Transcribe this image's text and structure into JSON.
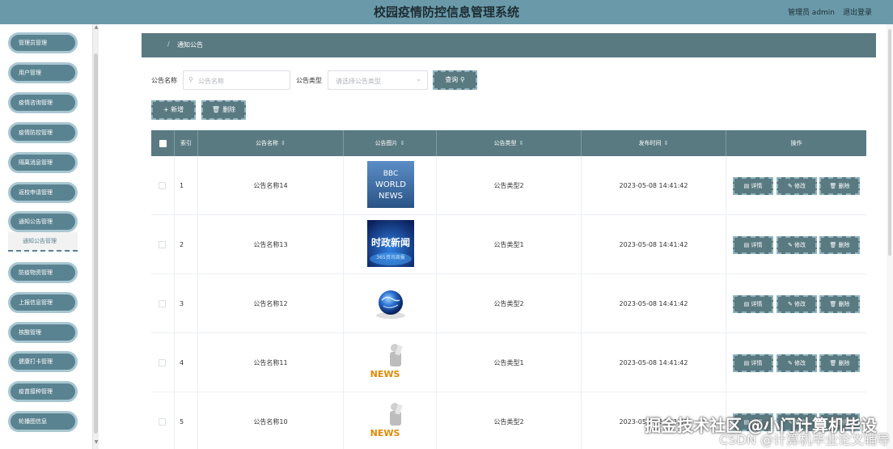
{
  "header": {
    "title": "校园疫情防控信息管理系统",
    "user": "管理员 admin",
    "logout": "退出登录"
  },
  "sidebar": {
    "items": [
      {
        "label": "管理员管理"
      },
      {
        "label": "用户管理"
      },
      {
        "label": "疫情咨询管理"
      },
      {
        "label": "疫情防控管理"
      },
      {
        "label": "隔离消息管理"
      },
      {
        "label": "返校申请管理"
      },
      {
        "label": "通知公告管理"
      },
      {
        "label": "通知公告管理",
        "sub": true
      },
      {
        "label": "防疫物资管理"
      },
      {
        "label": "上报信息管理"
      },
      {
        "label": "核酸管理"
      },
      {
        "label": "健康打卡管理"
      },
      {
        "label": "疫苗接种管理"
      },
      {
        "label": "轮播图信息"
      }
    ]
  },
  "breadcrumb": {
    "slash": "/",
    "current": "通知公告"
  },
  "search": {
    "name_label": "公告名称",
    "name_placeholder": "公告名称",
    "type_label": "公告类型",
    "type_placeholder": "请选择公告类型",
    "query_label": "查询"
  },
  "toolbar": {
    "add_label": "+ 新增",
    "delete_label": "删除"
  },
  "table": {
    "headers": {
      "index": "索引",
      "name": "公告名称",
      "image": "公告图片",
      "type": "公告类型",
      "time": "发布时间",
      "ops": "操作"
    },
    "rows": [
      {
        "index": "1",
        "name": "公告名称14",
        "image": "bbc-world-news",
        "type": "公告类型2",
        "time": "2023-05-08 14:41:42"
      },
      {
        "index": "2",
        "name": "公告名称13",
        "image": "politics-news",
        "type": "公告类型1",
        "time": "2023-05-08 14:41:42"
      },
      {
        "index": "3",
        "name": "公告名称12",
        "image": "globe",
        "type": "公告类型2",
        "time": "2023-05-08 14:41:42"
      },
      {
        "index": "4",
        "name": "公告名称11",
        "image": "news-figure",
        "type": "公告类型1",
        "time": "2023-05-08 14:41:42"
      },
      {
        "index": "5",
        "name": "公告名称10",
        "image": "news-figure",
        "type": "公告类型2",
        "time": "2023-05-08 14:41:42"
      }
    ],
    "ops": {
      "detail": "详情",
      "edit": "修改",
      "delete": "删除"
    }
  },
  "thumbs": {
    "bbc_line1": "BBC",
    "bbc_line2": "WORLD",
    "bbc_line3": "NEWS",
    "politics_line1": "时政新闻",
    "politics_line2": "365资讯周报",
    "news_word": "NEWS"
  },
  "watermark": {
    "line1": "掘金技术社区 @小门计算机毕设",
    "line2": "CSDN @计算机毕业论文辅导"
  },
  "colors": {
    "header_bg": "#6a9aaa",
    "primary": "#5a7a82",
    "menu_bg": "#5a8391"
  }
}
